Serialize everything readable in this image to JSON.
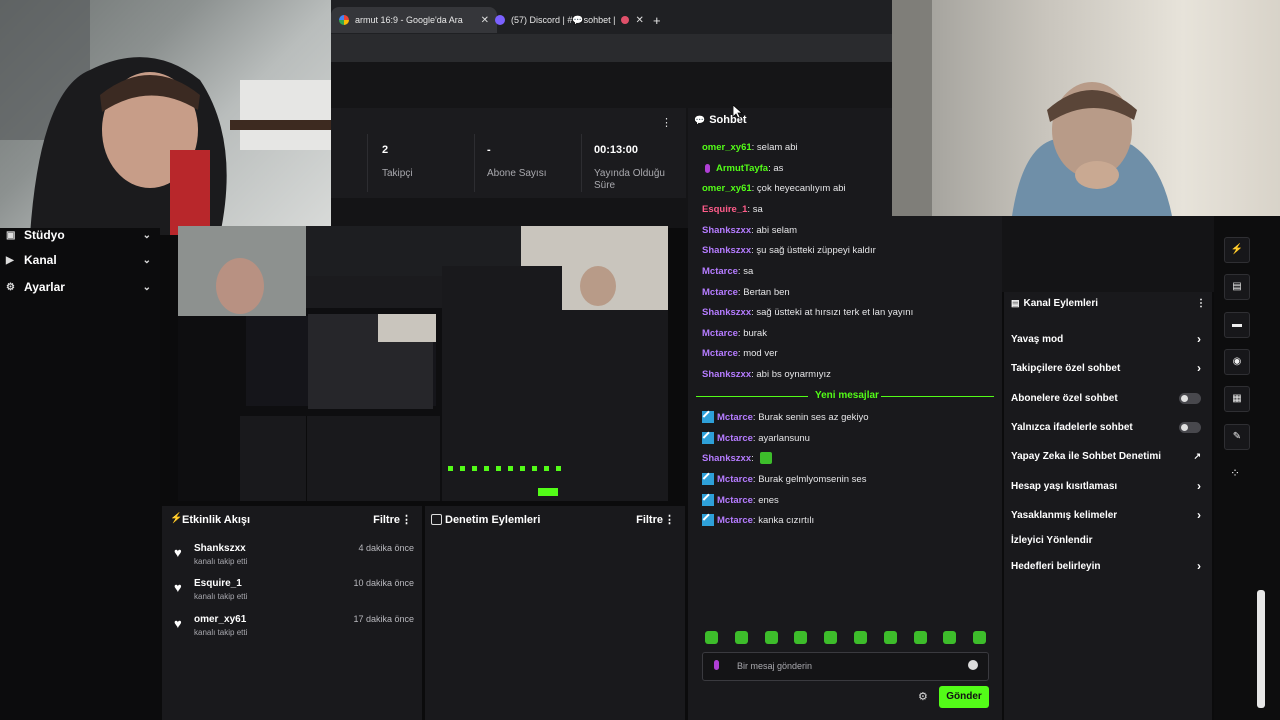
{
  "browser": {
    "tabs": [
      {
        "label": "armut 16:9 - Google'da Ara",
        "icon": "google-icon"
      },
      {
        "label": "(57) Discord | #💬sohbet | ",
        "icon": "discord-icon"
      }
    ],
    "new_tab": "+"
  },
  "stats": [
    {
      "value": "",
      "label": ""
    },
    {
      "value": "2",
      "label": "Takipçi"
    },
    {
      "value": "-",
      "label": "Abone Sayısı"
    },
    {
      "value": "00:13:00",
      "label": "Yayında Olduğu Süre"
    }
  ],
  "nav": {
    "items": [
      {
        "label": "Stüdyo"
      },
      {
        "label": "Kanal"
      },
      {
        "label": "Ayarlar"
      }
    ]
  },
  "activity": {
    "title": "Etkinlik Akışı",
    "filter": "Filtre",
    "items": [
      {
        "name": "Shankszxx",
        "sub": "kanalı takip etti",
        "time": "4 dakika önce"
      },
      {
        "name": "Esquire_1",
        "sub": "kanalı takip etti",
        "time": "10 dakika önce"
      },
      {
        "name": "omer_xy61",
        "sub": "kanalı takip etti",
        "time": "17 dakika önce"
      }
    ]
  },
  "moderation": {
    "title": "Denetim Eylemleri",
    "filter": "Filtre"
  },
  "chat": {
    "title": "Sohbet",
    "messages": [
      {
        "user": "omer_xy61",
        "text": ": selam abi",
        "color": "#53fc18"
      },
      {
        "user": "ArmutTayfa",
        "text": ": as",
        "color": "#53fc18"
      },
      {
        "user": "omer_xy61",
        "text": ": çok heyecanlıyım abi",
        "color": "#53fc18"
      },
      {
        "user": "Esquire_1",
        "text": ": sa",
        "color": "#ff5c8a"
      },
      {
        "user": "Shankszxx",
        "text": ": abi selam",
        "color": "#b57cff"
      },
      {
        "user": "Shankszxx",
        "text": ": şu sağ üstteki züppeyi kaldır",
        "color": "#b57cff"
      },
      {
        "user": "Mctarce",
        "text": ": sa",
        "color": "#b57cff"
      },
      {
        "user": "Mctarce",
        "text": ": Bertan ben",
        "color": "#b57cff"
      },
      {
        "user": "Shankszxx",
        "text": ": sağ üstteki at hırsızı terk et lan yayını",
        "color": "#b57cff"
      },
      {
        "user": "Mctarce",
        "text": ": burak",
        "color": "#b57cff"
      },
      {
        "user": "Mctarce",
        "text": ": mod ver",
        "color": "#b57cff"
      },
      {
        "user": "Shankszxx",
        "text": ": abi bs oynarmıyız",
        "color": "#b57cff"
      }
    ],
    "new_messages_label": "Yeni mesajlar",
    "new_messages": [
      {
        "user": "Mctarce",
        "text": ": Burak senin ses az gekiyo",
        "color": "#b57cff"
      },
      {
        "user": "Mctarce",
        "text": ": ayarlansunu",
        "color": "#b57cff"
      },
      {
        "user": "Shankszxx",
        "text": ":",
        "color": "#b57cff"
      },
      {
        "user": "Mctarce",
        "text": ": Burak gelmlyomsenin ses",
        "color": "#b57cff"
      },
      {
        "user": "Mctarce",
        "text": ": enes",
        "color": "#b57cff"
      },
      {
        "user": "Mctarce",
        "text": ": kanka cızırtılı",
        "color": "#b57cff"
      }
    ],
    "input_placeholder": "Bir mesaj gönderin",
    "send_label": "Gönder"
  },
  "channel_actions": {
    "title": "Kanal Eylemleri",
    "items": [
      {
        "label": "Yavaş mod",
        "control": "chevron"
      },
      {
        "label": "Takipçilere özel sohbet",
        "control": "chevron"
      },
      {
        "label": "Abonelere özel sohbet",
        "control": "toggle"
      },
      {
        "label": "Yalnızca ifadelerle sohbet",
        "control": "toggle"
      },
      {
        "label": "Yapay Zeka ile Sohbet Denetimi",
        "control": "external"
      },
      {
        "label": "Hesap yaşı kısıtlaması",
        "control": "chevron"
      },
      {
        "label": "Yasaklanmış kelimeler",
        "control": "chevron"
      },
      {
        "label": "İzleyici Yönlendir",
        "control": "none"
      },
      {
        "label": "Hedefleri belirleyin",
        "control": "chevron"
      }
    ]
  },
  "colors": {
    "accent": "#53fc18",
    "panel": "#19191c",
    "background": "#0b0b0c"
  }
}
